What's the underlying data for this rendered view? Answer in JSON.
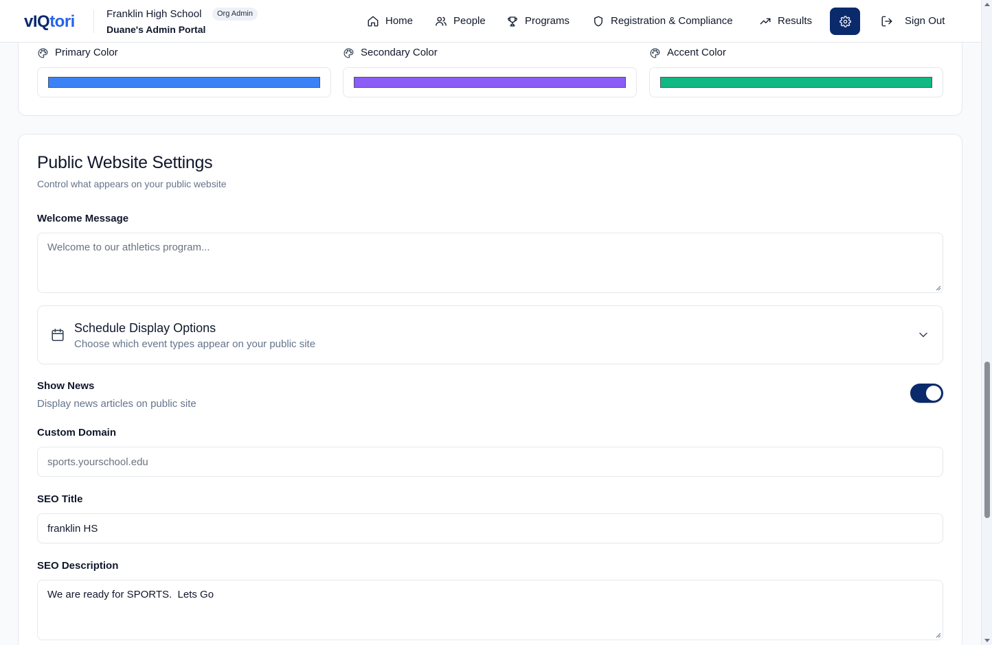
{
  "header": {
    "logo_part1": "vIQ",
    "logo_part2": "tori",
    "org_name": "Franklin High School",
    "org_badge": "Org Admin",
    "portal_name": "Duane's Admin Portal",
    "nav": [
      {
        "label": "Home",
        "icon": "home-icon"
      },
      {
        "label": "People",
        "icon": "users-icon"
      },
      {
        "label": "Programs",
        "icon": "trophy-icon"
      },
      {
        "label": "Registration & Compliance",
        "icon": "shield-icon"
      },
      {
        "label": "Results",
        "icon": "trending-up-icon"
      },
      {
        "label": "Sign Out",
        "icon": "log-out-icon"
      }
    ],
    "settings_icon": "gear-icon"
  },
  "colors": {
    "primary": {
      "label": "Primary Color",
      "value": "#3b82f6"
    },
    "secondary": {
      "label": "Secondary Color",
      "value": "#8b5cf6"
    },
    "accent": {
      "label": "Accent Color",
      "value": "#10b981"
    }
  },
  "public_site": {
    "title": "Public Website Settings",
    "subtitle": "Control what appears on your public website",
    "welcome": {
      "label": "Welcome Message",
      "placeholder": "Welcome to our athletics program...",
      "value": ""
    },
    "schedule": {
      "title": "Schedule Display Options",
      "subtitle": "Choose which event types appear on your public site",
      "expanded": false
    },
    "show_news": {
      "label": "Show News",
      "description": "Display news articles on public site",
      "enabled": true
    },
    "custom_domain": {
      "label": "Custom Domain",
      "placeholder": "sports.yourschool.edu",
      "value": ""
    },
    "seo_title": {
      "label": "SEO Title",
      "value": "franklin HS"
    },
    "seo_description": {
      "label": "SEO Description",
      "value": "We are ready for SPORTS.  Lets Go"
    }
  },
  "theme": {
    "brand_navy": "#0b2a6b",
    "brand_blue": "#2563eb"
  }
}
